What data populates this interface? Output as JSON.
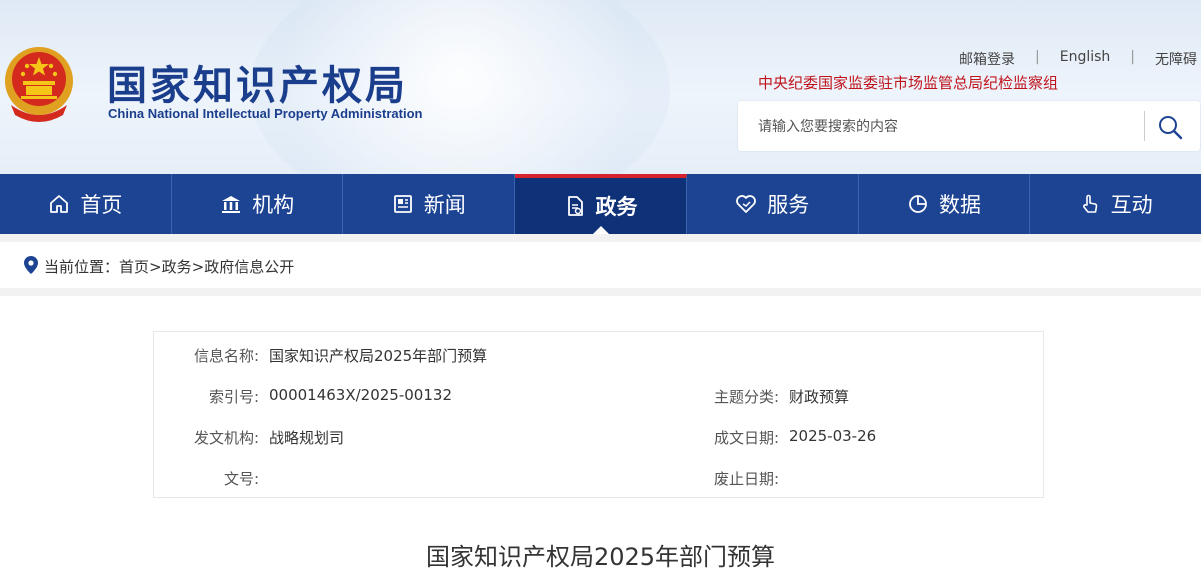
{
  "header": {
    "logo_cn": "国家知识产权局",
    "logo_en": "China National Intellectual Property Administration",
    "links": [
      "邮箱登录",
      "English",
      "无障碍"
    ],
    "discipline_link": "中央纪委国家监委驻市场监管总局纪检监察组"
  },
  "search": {
    "placeholder": "请输入您要搜索的内容"
  },
  "nav": [
    {
      "label": "首页",
      "icon": "home-icon"
    },
    {
      "label": "机构",
      "icon": "building-icon"
    },
    {
      "label": "新闻",
      "icon": "newspaper-icon"
    },
    {
      "label": "政务",
      "icon": "document-icon",
      "active": true
    },
    {
      "label": "服务",
      "icon": "heart-hand-icon"
    },
    {
      "label": "数据",
      "icon": "pie-chart-icon"
    },
    {
      "label": "互动",
      "icon": "hand-pointer-icon"
    }
  ],
  "breadcrumb": {
    "prefix": "当前位置：",
    "items": [
      "首页",
      "政务",
      "政府信息公开"
    ]
  },
  "meta": {
    "name_label": "信息名称:",
    "name_value": "国家知识产权局2025年部门预算",
    "index_label": "索引号:",
    "index_value": "00001463X/2025-00132",
    "topic_label": "主题分类:",
    "topic_value": "财政预算",
    "issuer_label": "发文机构:",
    "issuer_value": "战略规划司",
    "date_label": "成文日期:",
    "date_value": "2025-03-26",
    "docno_label": "文号:",
    "docno_value": "",
    "expire_label": "废止日期:",
    "expire_value": ""
  },
  "article": {
    "title": "国家知识产权局2025年部门预算"
  },
  "colors": {
    "brand": "#1d4493",
    "active": "#0f3177",
    "accent_red": "#d7232e",
    "discipline": "#c0141c"
  }
}
